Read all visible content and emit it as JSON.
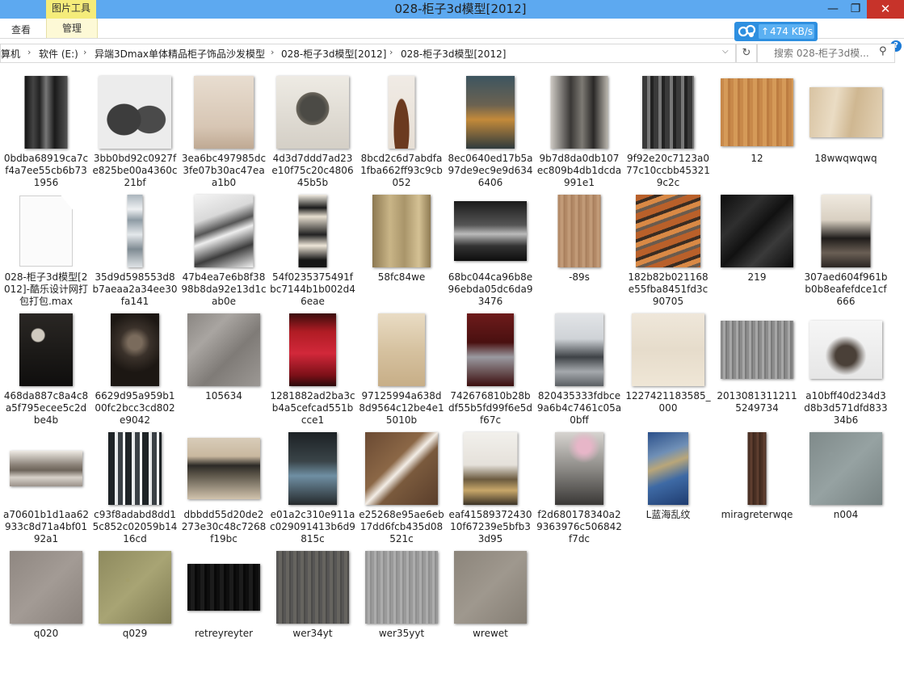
{
  "window": {
    "title": "028-柜子3d模型[2012]"
  },
  "ribbon": {
    "tool_tab": "图片工具",
    "tabs": [
      "查看",
      "管理"
    ]
  },
  "speed": {
    "text": "474 KB/s"
  },
  "breadcrumb": [
    "算机",
    "软件 (E:)",
    "异端3Dmax单体精品柜子饰品沙发模型",
    "028-柜子3d模型[2012]",
    "028-柜子3d模型[2012]"
  ],
  "search": {
    "placeholder": "搜索 028-柜子3d模..."
  },
  "files": [
    {
      "name": "0bdba68919ca7cf4a7ee55cb6b731956",
      "w": 53,
      "h": 90,
      "bg": "linear-gradient(90deg,#111 0%,#444 20%,#222 35%,#777 50%,#1a1a1a 70%,#555 100%)"
    },
    {
      "name": "3bb0bd92c0927fe825be00a4360c21bf",
      "w": 90,
      "h": 90,
      "bg": "radial-gradient(ellipse at 35% 60%,#3d3d3d 25%,transparent 26%),radial-gradient(ellipse at 70% 60%,#4a4a4a 22%,transparent 23%),#ececec"
    },
    {
      "name": "3ea6bc497985dc3fe07b30ac47eaa1b0",
      "w": 74,
      "h": 90,
      "bg": "linear-gradient(180deg,#e8ddd0 0%,#d7c6b4 70%,#bfa993 100%)"
    },
    {
      "name": "4d3d7ddd7ad23e10f75c20c480645b5b",
      "w": 90,
      "h": 90,
      "bg": "radial-gradient(circle at 50% 45%,#4b4a45 22%,#6b665c 30%,transparent 31%),linear-gradient(180deg,#eeebe4,#d4cfc6)"
    },
    {
      "name": "8bcd2c6d7abdfa1fba662ff93c9cb052",
      "w": 33,
      "h": 90,
      "bg": "radial-gradient(ellipse at 50% 75%,#6b3a1f 40%,transparent 42%),linear-gradient(180deg,#f0ebe5,#e7dfd5)"
    },
    {
      "name": "8ec0640ed17b5a97de9ec9e9d6346406",
      "w": 60,
      "h": 90,
      "bg": "linear-gradient(180deg,#3d5560 0%,#6b6251 40%,#c38a3a 60%,#2f3a3d 100%)"
    },
    {
      "name": "9b7d8da0db107ec809b4db1dcda991e1",
      "w": 71,
      "h": 90,
      "bg": "linear-gradient(90deg,#cfcbc5 0%,#3a3836 35%,#7d7a74 55%,#2a2827 75%,#bab6ae 100%)"
    },
    {
      "name": "9f92e20c7123a077c10ccbb453219c2c",
      "w": 64,
      "h": 90,
      "bg": "repeating-linear-gradient(90deg,#3a3a3a 0 6px,#777 6px 10px,#222 10px 14px)"
    },
    {
      "name": "12",
      "w": 90,
      "h": 84,
      "bg": "repeating-linear-gradient(90deg,#c8894a 0 4px,#d59a58 4px 9px,#bd7d41 9px 12px)"
    },
    {
      "name": "18wwqwqwq",
      "w": 90,
      "h": 62,
      "bg": "linear-gradient(100deg,#d8c3a2,#eadcc4 35%,#cfb791 60%,#e3d2b6)"
    },
    {
      "name": "028-柜子3d模型[2012]-酷乐设计网打包打包.max",
      "w": 64,
      "h": 86,
      "doc": true,
      "bg": "#fbfbfb"
    },
    {
      "name": "35d9d598553d8b7aeaa2a34ee30fa141",
      "w": 19,
      "h": 90,
      "bg": "linear-gradient(180deg,#aab5bd 0%,#eef0f2 20%,#8e9ba4 35%,#e4e8eb 55%,#7f8b93 75%,#dfe3e6 100%)"
    },
    {
      "name": "47b4ea7e6b8f3898b8da92e13d1cab0e",
      "w": 73,
      "h": 90,
      "bg": "linear-gradient(160deg,#f4f4f4 0%,#d9d9d9 30%,#555 45%,#eee 55%,#3d3d3d 75%,#f2f2f2 100%)"
    },
    {
      "name": "54f0235375491fbc7144b1b002d46eae",
      "w": 35,
      "h": 90,
      "bg": "linear-gradient(180deg,#f2ede2 0%,#1b1b1b 18%,#e7dfd0 30%,#222 55%,#eee6d8 70%,#151515 90%)"
    },
    {
      "name": "58fc84we",
      "w": 72,
      "h": 90,
      "bg": "linear-gradient(90deg,#8c7851,#c9b587 30%,#a9956a 55%,#d4c194 80%,#8f7b53)"
    },
    {
      "name": "68bc044ca96b8e96ebda05dc6da93476",
      "w": 90,
      "h": 74,
      "bg": "linear-gradient(180deg,#1a1a1a 0%,#555 40%,#bbb 55%,#333 75%,#0e0e0e 100%)"
    },
    {
      "name": "-89s",
      "w": 53,
      "h": 90,
      "bg": "repeating-linear-gradient(90deg,#b38a67 0 3px,#c19a77 3px 7px,#a87f5d 7px 9px)"
    },
    {
      "name": "182b82b021168e55fba8451fd3c90705",
      "w": 80,
      "h": 90,
      "bg": "repeating-linear-gradient(160deg,#b9602a 0 8px,#3a2c22 8px 12px,#d98945 12px 18px,#6b5b4d 18px 22px)"
    },
    {
      "name": "219",
      "w": 90,
      "h": 90,
      "bg": "linear-gradient(135deg,#0d0d0d 0%,#2f2f2f 30%,#111 50%,#3a3a3a 70%,#0a0a0a 100%)"
    },
    {
      "name": "307aed604f961bb0b8eafefdce1cf666",
      "w": 61,
      "h": 90,
      "bg": "linear-gradient(180deg,#efe9df 0%,#d9d0c2 35%,#1f1c1a 60%,#6a5f55 80%,#2b2522 100%)"
    },
    {
      "name": "468da887c8a4c8a5f795ecee5c2dbe4b",
      "w": 66,
      "h": 90,
      "bg": "radial-gradient(circle at 35% 30%,#cfc9bf 10%,transparent 12%),linear-gradient(180deg,#2a2724,#0f0e0d)"
    },
    {
      "name": "6629d95a959b100fc2bcc3cd802e9042",
      "w": 60,
      "h": 90,
      "bg": "radial-gradient(circle at 50% 40%,#7a6b5c 14%,#3b322b 30%,#1c1713 60%)"
    },
    {
      "name": "105634",
      "w": 90,
      "h": 90,
      "bg": "linear-gradient(135deg,#8a8682,#a9a5a1 30%,#7f7b77 60%,#9c9894)"
    },
    {
      "name": "1281882ad2ba3cb4a5cefcad551bcce1",
      "w": 58,
      "h": 90,
      "bg": "linear-gradient(180deg,#3a0c0c 0%,#b01c24 25%,#d2283a 55%,#7c1018 85%,#2a0a0a 100%)"
    },
    {
      "name": "97125994a638d8d9564c12be4e15010b",
      "w": 58,
      "h": 90,
      "bg": "linear-gradient(180deg,#e9dcc4,#d6c2a0 50%,#c7ae87)"
    },
    {
      "name": "742676810b28bdf55b5fd99f6e5df67c",
      "w": 58,
      "h": 90,
      "bg": "linear-gradient(180deg,#6e1b1b 0%,#4a1010 40%,#9a9aa0 60%,#3b0d0d 100%)"
    },
    {
      "name": "820435333fdbce9a6b4c7461c05a0bff",
      "w": 60,
      "h": 90,
      "bg": "linear-gradient(180deg,#e2e4e7 0%,#cfd3d7 35%,#3e4246 60%,#a5a9ad 80%,#5b5f63 100%)"
    },
    {
      "name": "1227421183585_000",
      "w": 90,
      "h": 90,
      "bg": "linear-gradient(180deg,#efe7da,#e6dccb 50%,#efe6d6)"
    },
    {
      "name": "20130813112115249734",
      "w": 90,
      "h": 72,
      "bg": "repeating-linear-gradient(90deg,#8c8c8c 0 3px,#a6a6a6 3px 6px,#7a7a7a 6px 8px)"
    },
    {
      "name": "a10bff40d234d3d8b3d571dfd83334b6",
      "w": 90,
      "h": 72,
      "bg": "radial-gradient(ellipse at 50% 60%,#4a4038 20%,transparent 40%),linear-gradient(180deg,#f6f6f6,#e6e6e6)"
    },
    {
      "name": "a70601b1d1aa62933c8d71a4bf0192a1",
      "w": 90,
      "h": 44,
      "bg": "linear-gradient(180deg,#eeeae4 0%,#8b8278 40%,#6d645a 55%,#d8d2ca 75%,#9b928a 100%)"
    },
    {
      "name": "c93f8adabd8dd15c852c02059b1416cd",
      "w": 66,
      "h": 90,
      "bg": "repeating-linear-gradient(90deg,#1e2326 0 8px,#e8eaeb 8px 12px,#3a4045 12px 18px,#f1f2f3 18px 21px)"
    },
    {
      "name": "dbbdd55d20de2273e30c48c7268f19bc",
      "w": 90,
      "h": 76,
      "bg": "linear-gradient(180deg,#d8ccb9 0%,#c9b89f 30%,#2c2a26 45%,#5a5448 60%,#d1c3ad 100%)"
    },
    {
      "name": "e01a2c310e911ac029091413b6d9815c",
      "w": 60,
      "h": 90,
      "bg": "linear-gradient(180deg,#1c2124 0%,#3a4448 40%,#6f8fa3 60%,#25292b 100%)"
    },
    {
      "name": "e25268e95ae6eb17dd6fcb435d08521c",
      "w": 90,
      "h": 90,
      "bg": "linear-gradient(135deg,#6a4a33 0%,#8b6746 40%,#f3eee7 50%,#7a5a3d 60%,#5a3e2b 100%)"
    },
    {
      "name": "eaf4158937243010f67239e5bfb33d95",
      "w": 67,
      "h": 90,
      "bg": "linear-gradient(180deg,#f2f0ec 0%,#e5e1da 45%,#6b5a3f 65%,#c8a76a 80%,#3a3226 100%)"
    },
    {
      "name": "f2d680178340a29363976c506842f7dc",
      "w": 60,
      "h": 90,
      "bg": "radial-gradient(circle at 60% 20%,#e7b6c8 10%,transparent 25%),linear-gradient(180deg,#d7d4d0 0%,#8c8a86 50%,#3a3836 100%)"
    },
    {
      "name": "L蓝海乱纹",
      "w": 50,
      "h": 90,
      "bg": "linear-gradient(160deg,#2a4f8a 0%,#6f8fb6 30%,#b9a679 45%,#3e6aa5 65%,#1f3c70 100%)"
    },
    {
      "name": "miragreterwqe",
      "w": 23,
      "h": 90,
      "bg": "repeating-linear-gradient(90deg,#4a3024 0 3px,#5e3e2f 3px 6px,#3d271d 6px 8px)"
    },
    {
      "name": "n004",
      "w": 90,
      "h": 90,
      "bg": "radial-gradient(circle at 30% 30%,#8e9a9a 2px,transparent 3px),linear-gradient(135deg,#7f8a8a,#96a2a2 50%,#778282)"
    },
    {
      "name": "q020",
      "w": 90,
      "h": 90,
      "bg": "linear-gradient(135deg,#8f8781,#a39b95 50%,#8a827c)"
    },
    {
      "name": "q029",
      "w": 90,
      "h": 90,
      "bg": "radial-gradient(circle at 40% 40%,#a39e6b 2px,transparent 3px),linear-gradient(135deg,#8e8a5e,#a8a474 50%,#7f7b52)"
    },
    {
      "name": "retreyreyter",
      "w": 90,
      "h": 58,
      "bg": "repeating-linear-gradient(90deg,#0e0e0e 0 4px,#1c1c1c 4px 9px,#080808 9px 12px)"
    },
    {
      "name": "wer34yt",
      "w": 90,
      "h": 90,
      "bg": "repeating-linear-gradient(90deg,#575655 0 3px,#66645f 3px 7px,#4c4b49 7px 9px)"
    },
    {
      "name": "wer35yyt",
      "w": 90,
      "h": 90,
      "bg": "repeating-linear-gradient(90deg,#9a9a9a 0 3px,#acacac 3px 6px,#8f8f8f 6px 8px)"
    },
    {
      "name": "wrewet",
      "w": 90,
      "h": 90,
      "bg": "linear-gradient(135deg,#8c857b,#9f988e 50%,#857e74)"
    }
  ]
}
